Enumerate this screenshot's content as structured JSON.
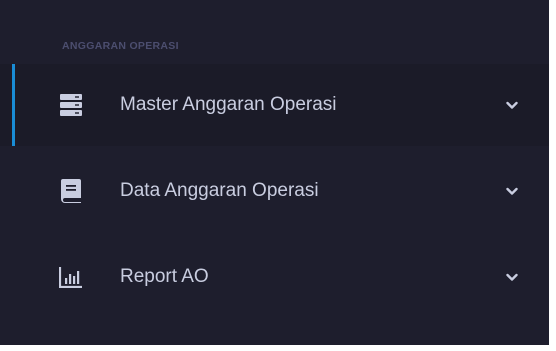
{
  "sidebar": {
    "section_title": "ANGGARAN OPERASI",
    "accent_color": "#1a8dd6",
    "items": [
      {
        "label": "Master Anggaran Operasi",
        "icon": "server-icon",
        "active": true
      },
      {
        "label": "Data Anggaran Operasi",
        "icon": "book-icon",
        "active": false
      },
      {
        "label": "Report AO",
        "icon": "chart-bar-icon",
        "active": false
      }
    ]
  }
}
